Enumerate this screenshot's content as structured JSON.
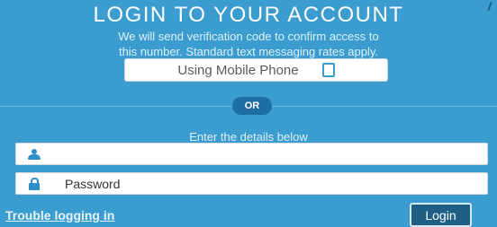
{
  "login": {
    "title": "LOGIN TO YOUR ACCOUNT",
    "subtitle_line1": "We will send verification code to confirm access to",
    "subtitle_line2": "this number. Standard text messaging rates apply.",
    "mobile_button_label": "Using Mobile Phone",
    "or_label": "OR",
    "details_label": "Enter the details below",
    "username_value": "",
    "password_placeholder": "Password",
    "trouble_link": "Trouble logging in",
    "login_button": "Login"
  },
  "icons": {
    "phone": "phone-icon",
    "user": "user-icon",
    "lock": "lock-icon"
  },
  "colors": {
    "background": "#3a9ccf",
    "or_badge": "#1e6ea3",
    "login_button": "#1f5f86",
    "icon": "#2c8fc7"
  }
}
